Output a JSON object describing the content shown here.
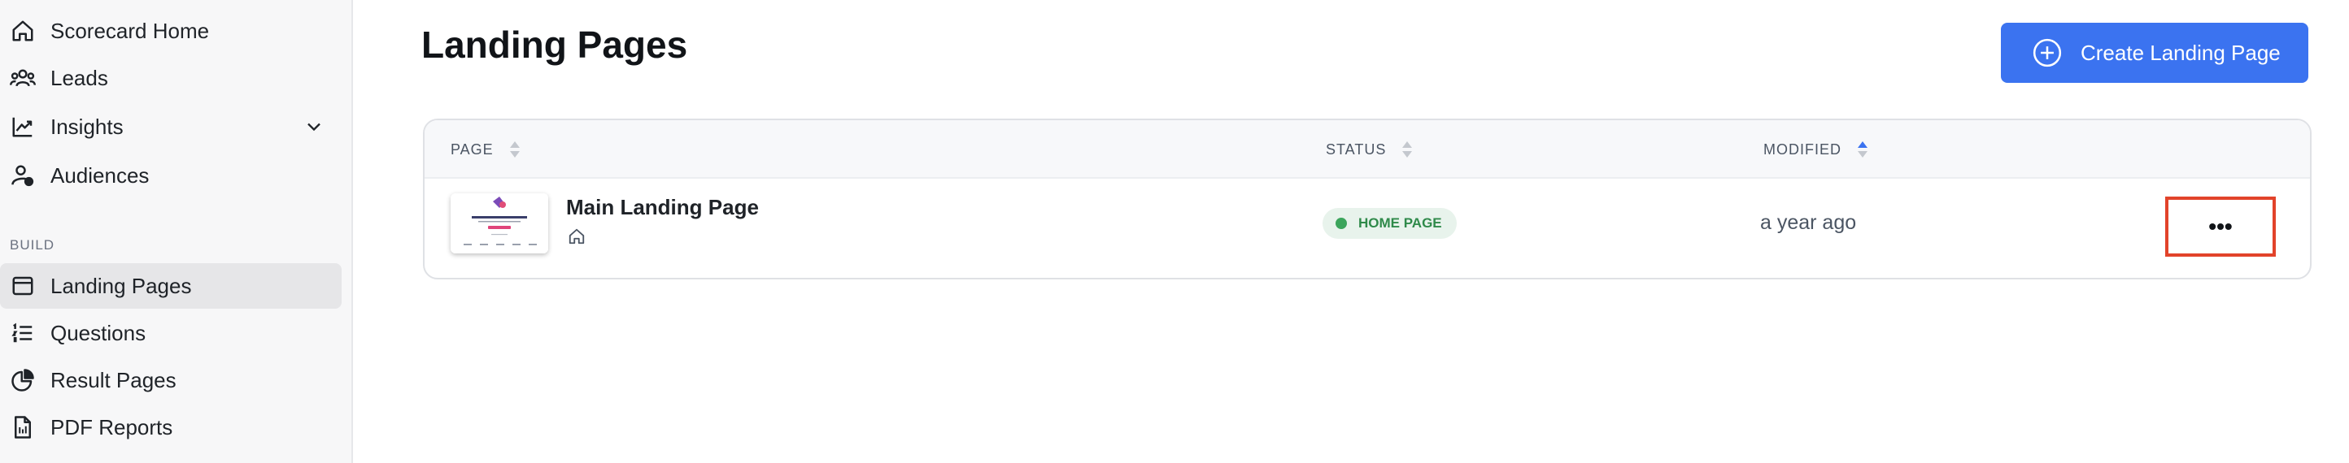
{
  "sidebar": {
    "items": [
      {
        "label": "Scorecard Home",
        "icon": "home-icon"
      },
      {
        "label": "Leads",
        "icon": "users-icon"
      },
      {
        "label": "Insights",
        "icon": "chart-line-icon"
      },
      {
        "label": "Audiences",
        "icon": "user-badge-icon"
      }
    ],
    "section_label": "BUILD",
    "build_items": [
      {
        "label": "Landing Pages",
        "icon": "browser-window-icon",
        "active": true
      },
      {
        "label": "Questions",
        "icon": "list-icon"
      },
      {
        "label": "Result Pages",
        "icon": "pie-chart-icon"
      },
      {
        "label": "PDF Reports",
        "icon": "pdf-file-icon"
      }
    ]
  },
  "main": {
    "title": "Landing Pages",
    "create_button_label": "Create Landing Page",
    "table": {
      "headers": [
        "PAGE",
        "STATUS",
        "MODIFIED"
      ],
      "rows": [
        {
          "title": "Main Landing Page",
          "status": "HOME PAGE",
          "modified": "a year ago",
          "more_label": "•••"
        }
      ]
    }
  },
  "colors": {
    "accent": "#3b73f0",
    "status_green": "#3ca55c",
    "highlight_red": "#e2432a"
  }
}
